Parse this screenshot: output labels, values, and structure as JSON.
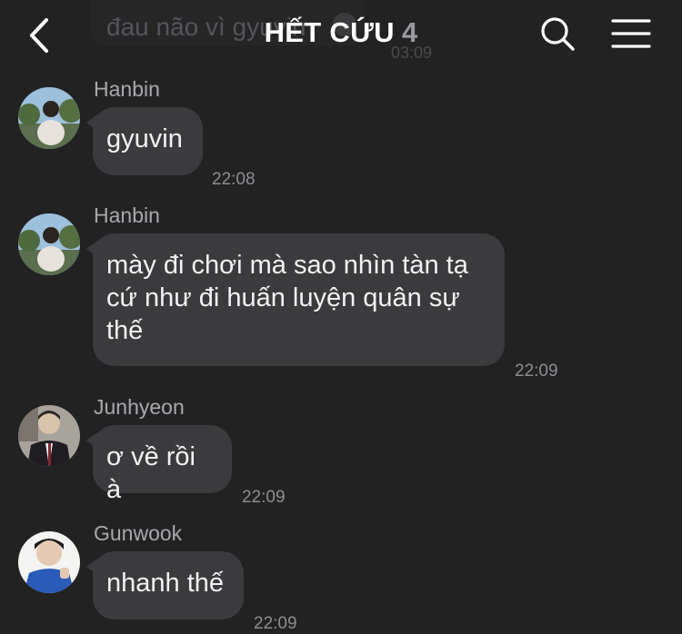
{
  "header": {
    "title": "HẾT CỨU",
    "member_count": "4",
    "back_icon": "chevron-left-icon",
    "search_icon": "search-icon",
    "menu_icon": "hamburger-menu-icon"
  },
  "ghost": {
    "text": "đau não vì gyuvin",
    "time": "03:09"
  },
  "messages": [
    {
      "sender": "Hanbin",
      "text": "gyuvin",
      "time": "22:08"
    },
    {
      "sender": "Hanbin",
      "text": "mày đi chơi mà sao nhìn tàn tạ cứ như đi huấn luyện quân sự thế",
      "time": "22:09"
    },
    {
      "sender": "Junhyeon",
      "text": "ơ về rồi à",
      "time": "22:09"
    },
    {
      "sender": "Gunwook",
      "text": "nhanh thế",
      "time": "22:09"
    }
  ],
  "colors": {
    "background": "#222223",
    "bubble": "#3b3b3d",
    "text": "#f2f2f2",
    "meta": "#8e8e90"
  }
}
